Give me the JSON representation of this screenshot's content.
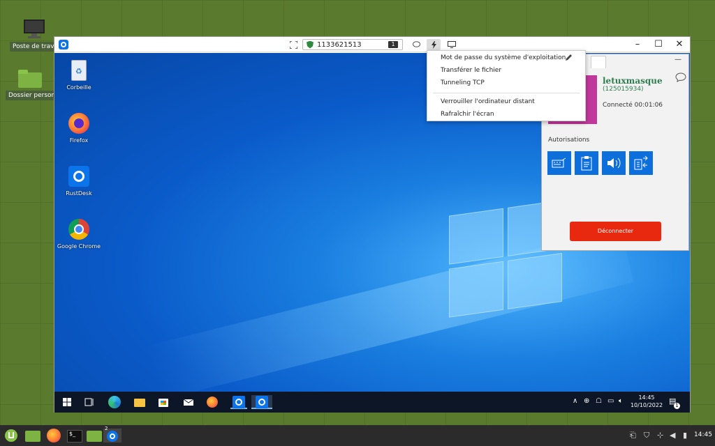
{
  "host_desktop": {
    "icons": [
      {
        "label": "Poste de trava",
        "icon": "computer-icon"
      },
      {
        "label": "Dossier person",
        "icon": "folder-icon"
      }
    ]
  },
  "rustdesk": {
    "remote_id": "1133621513",
    "display_number": "1",
    "menu": {
      "items": [
        "Mot de passe du système d'exploitation",
        "Transférer le fichier",
        "Tunneling TCP",
        "Verrouiller l'ordinateur distant",
        "Rafraîchir l'écran"
      ]
    }
  },
  "remote_desktop": {
    "icons": [
      {
        "label": "Corbeille"
      },
      {
        "label": "Firefox"
      },
      {
        "label": "RustDesk"
      },
      {
        "label": "Google Chrome"
      }
    ],
    "taskbar": {
      "time": "14:45",
      "date": "10/10/2022",
      "notif_count": "1"
    }
  },
  "panel": {
    "user_name": "letuxmasque",
    "user_id": "(125015934)",
    "connected": "Connecté 00:01:06",
    "permissions_title": "Autorisations",
    "disconnect": "Déconnecter"
  },
  "host_panel": {
    "workspace_badge": "2",
    "time": "14:45"
  },
  "colors": {
    "accent": "#0c6fdc",
    "disconnect": "#e8290f",
    "host_bg": "#5a7a2e",
    "user_name": "#2e7d4f"
  }
}
